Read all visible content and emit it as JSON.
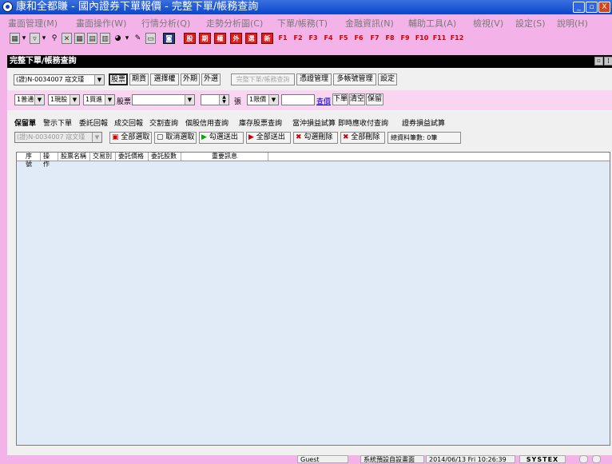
{
  "window": {
    "title": "康和全都賺 - 國內證券下單報價 - 完整下單/帳務查詢",
    "minimize": "_",
    "maximize": "▫",
    "close": "X"
  },
  "menu": [
    "畫面管理(M)",
    "畫面操作(W)",
    "行情分析(Q)",
    "走勢分析圖(C)",
    "下單/帳務(T)",
    "金融資訊(N)",
    "輔助工具(A)",
    "檢視(V)",
    "設定(S)",
    "說明(H)"
  ],
  "toolbar": {
    "red_buttons": [
      "股",
      "期",
      "權",
      "外",
      "選",
      "新"
    ],
    "fkeys": [
      "F1",
      "F2",
      "F3",
      "F4",
      "F5",
      "F6",
      "F7",
      "F8",
      "F9",
      "F10",
      "F11",
      "F12"
    ]
  },
  "panel": {
    "title": "完整下單/帳務查詢"
  },
  "row1": {
    "account": "(證)N-0034007 寇文瑾",
    "type_buttons": [
      "股票",
      "期貨",
      "選擇權",
      "外期",
      "外選"
    ],
    "disabled_button": "完整下單/帳務查詢",
    "buttons": [
      "憑證管理",
      "多帳號管理",
      "設定"
    ]
  },
  "row2": {
    "trade_type": "1普通",
    "cash_type": "1現股",
    "buy_sell": "1買進",
    "stock_label": "股票",
    "stock_value": "",
    "qty_value": "",
    "qty_unit": "張",
    "price_type": "1限價",
    "price_value": "",
    "query_price_link": "查價",
    "buttons": [
      "下單",
      "清空",
      "保留"
    ]
  },
  "tabs": [
    "保留單",
    "警示下單",
    "委託回報",
    "成交回報",
    "交割查詢",
    "個股信用查詢",
    "庫存股票查詢",
    "當沖損益試算",
    "即時應收付查詢",
    "證券損益試算"
  ],
  "actions": {
    "account": "(證)N-0034007 寇文瑾",
    "buttons": [
      "全部選取",
      "取消選取",
      "勾選送出",
      "全部送出",
      "勾選刪除",
      "全部刪除"
    ],
    "total_label": "總資料筆數: 0筆"
  },
  "grid": {
    "columns": [
      "序號",
      "操作",
      "股票名稱",
      "交易別",
      "委託價格",
      "委託股數",
      "重要訊息"
    ]
  },
  "status": {
    "user": "Guest",
    "screen": "系統預設自設畫面",
    "datetime": "2014/06/13 Fri 10:26:39",
    "brand": "SYSTEX"
  }
}
